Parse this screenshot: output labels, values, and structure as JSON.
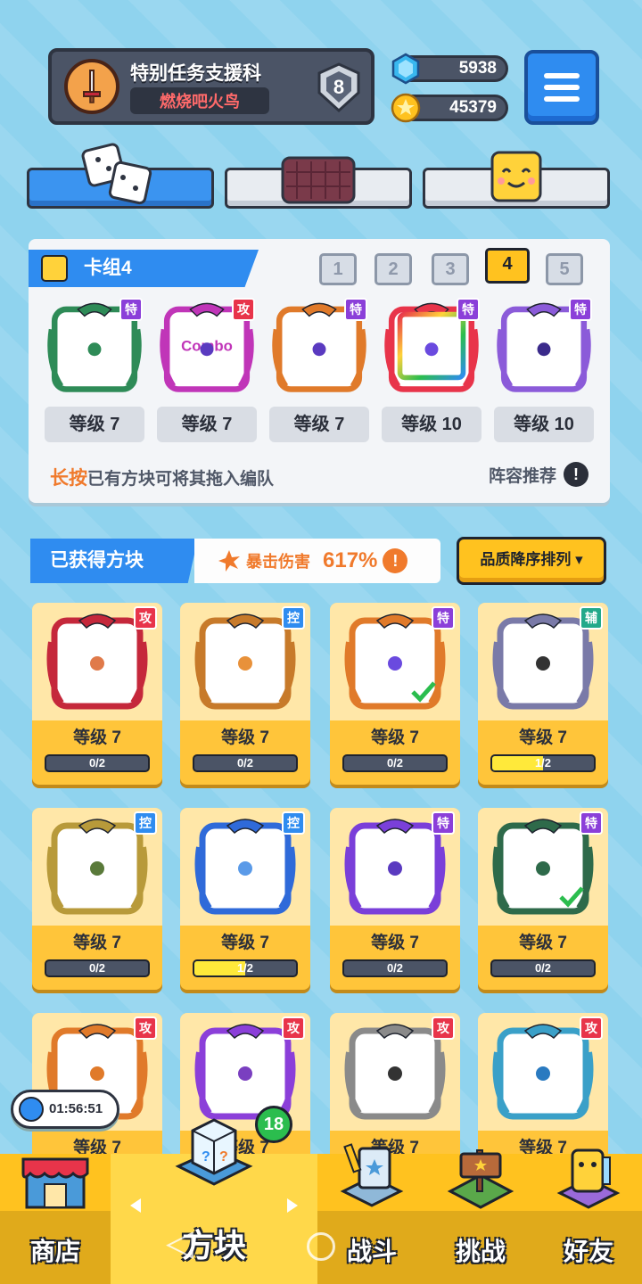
{
  "profile": {
    "name": "特别任务支援科",
    "title": "燃烧吧火鸟",
    "rank": "8",
    "avatar_icon": "sword-icon"
  },
  "currency": {
    "gems": "5938",
    "coins": "45379",
    "gem_icon": "gem-icon",
    "coin_icon": "star-coin-icon"
  },
  "top_tabs": [
    {
      "icon": "dice-icon",
      "active": true
    },
    {
      "icon": "board-icon",
      "active": false
    },
    {
      "icon": "smiley-block-icon",
      "active": false
    }
  ],
  "deck": {
    "label": "卡组4",
    "numbers": [
      "1",
      "2",
      "3",
      "4",
      "5"
    ],
    "active_number": "4",
    "cards": [
      {
        "tag": "特",
        "tag_type": "spec",
        "level": "等级 7",
        "frame_color": "#2e8b57",
        "inner": "pentagram",
        "text": ""
      },
      {
        "tag": "攻",
        "tag_type": "atk",
        "level": "等级 7",
        "frame_color": "#c035b8",
        "inner": "combo",
        "text": "Combo"
      },
      {
        "tag": "特",
        "tag_type": "spec",
        "level": "等级 7",
        "frame_color": "#e07a2a",
        "inner": "infinity",
        "text": ""
      },
      {
        "tag": "特",
        "tag_type": "spec",
        "level": "等级 10",
        "frame_color": "#e8344a",
        "inner": "rainbow",
        "text": ""
      },
      {
        "tag": "特",
        "tag_type": "spec",
        "level": "等级 10",
        "frame_color": "#8b5bd9",
        "inner": "crack",
        "text": ""
      }
    ],
    "hint_highlight": "长按",
    "hint_text": "已有方块可将其拖入编队",
    "recommend_label": "阵容推荐",
    "recommend_info": "!"
  },
  "acquired": {
    "label": "已获得方块",
    "crit_label": "暴击伤害",
    "crit_value": "617%",
    "crit_info": "!",
    "sort_label": "品质降序排列 ▾"
  },
  "blocks": [
    {
      "tag": "攻",
      "tag_type": "atk",
      "level": "等级 7",
      "progress": "0/2",
      "fill": 0,
      "frame": "#c5283b",
      "dot": "#e07a4a",
      "check": false
    },
    {
      "tag": "控",
      "tag_type": "ctrl",
      "level": "等级 7",
      "progress": "0/2",
      "fill": 0,
      "frame": "#c77a2a",
      "dot": "#e8913a",
      "check": false
    },
    {
      "tag": "特",
      "tag_type": "spec",
      "level": "等级 7",
      "progress": "0/2",
      "fill": 0,
      "frame": "#e07a2a",
      "dot": "#6a4adf",
      "check": true
    },
    {
      "tag": "辅",
      "tag_type": "sup",
      "level": "等级 7",
      "progress": "1/2",
      "fill": 0.5,
      "frame": "#7a7aa8",
      "dot": "#333333",
      "check": false
    },
    {
      "tag": "控",
      "tag_type": "ctrl",
      "level": "等级 7",
      "progress": "0/2",
      "fill": 0,
      "frame": "#b89a3a",
      "dot": "#5a7a3a",
      "check": false
    },
    {
      "tag": "控",
      "tag_type": "ctrl",
      "level": "等级 7",
      "progress": "1/2",
      "fill": 0.5,
      "frame": "#2f6ad9",
      "dot": "#5a9ae8",
      "check": false
    },
    {
      "tag": "特",
      "tag_type": "spec",
      "level": "等级 7",
      "progress": "0/2",
      "fill": 0,
      "frame": "#7a3fd9",
      "dot": "#5a3ac0",
      "check": false
    },
    {
      "tag": "特",
      "tag_type": "spec",
      "level": "等级 7",
      "progress": "0/2",
      "fill": 0,
      "frame": "#2e6a4a",
      "dot": "#2e6a4a",
      "check": true
    },
    {
      "tag": "攻",
      "tag_type": "atk",
      "level": "等级 7",
      "frame": "#e07a2a",
      "dot": "#e07a2a",
      "check": false
    },
    {
      "tag": "攻",
      "tag_type": "atk",
      "level": "等级 7",
      "frame": "#8b3fd9",
      "dot": "#7a3fc0",
      "check": false
    },
    {
      "tag": "攻",
      "tag_type": "atk",
      "level": "等级 7",
      "frame": "#8a8a8a",
      "dot": "#333333",
      "check": false
    },
    {
      "tag": "攻",
      "tag_type": "atk",
      "level": "等级 7",
      "frame": "#3aa0c8",
      "dot": "#2a7ac0",
      "check": false
    }
  ],
  "timer": {
    "value": "01:56:51",
    "icon": "stopwatch-icon"
  },
  "nav": {
    "shop": "商店",
    "blocks": "方块",
    "blocks_badge": "18",
    "battle": "战斗",
    "challenge": "挑战",
    "friends": "好友"
  },
  "colors": {
    "accent": "#2f8cf0",
    "nav_yellow": "#ffc21f",
    "crit_orange": "#f07a2c"
  }
}
